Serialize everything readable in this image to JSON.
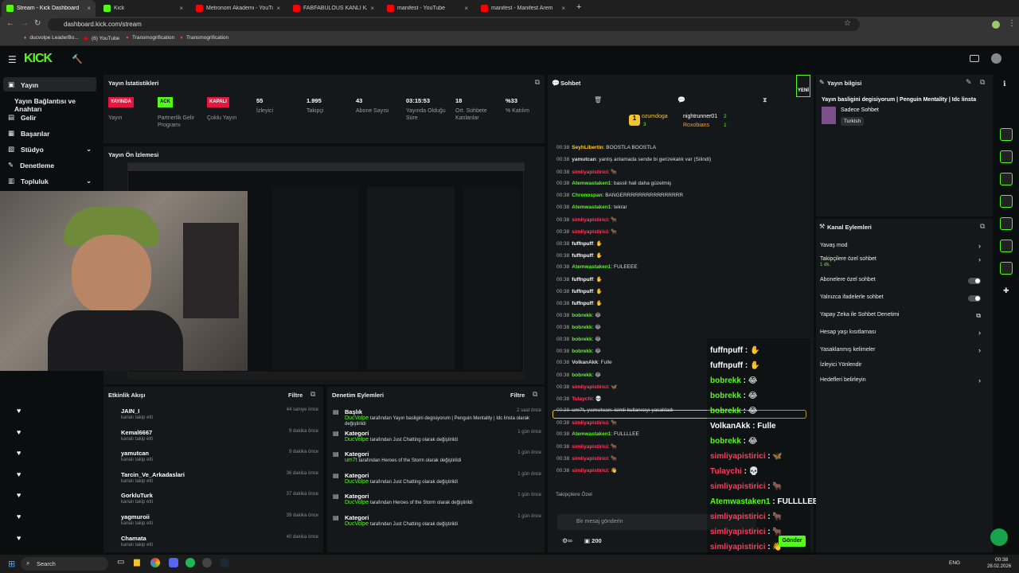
{
  "tabs": [
    {
      "label": "Stream - Kick Dashboard",
      "color": "#53fc18"
    },
    {
      "label": "Kick",
      "color": "#53fc18"
    },
    {
      "label": "Metronom Akademi - YouTube",
      "color": "#ff0000"
    },
    {
      "label": "FABFABULOUS KANLI KATMAN",
      "color": "#ff0000"
    },
    {
      "label": "manifest - YouTube",
      "color": "#ff0000"
    },
    {
      "label": "manifest - Manifest Arem",
      "color": "#ff0000"
    }
  ],
  "address": {
    "url": "dashboard.kick.com/stream"
  },
  "bookmarks": [
    "ducvolpe LeaderBo...",
    "(6) YouTube",
    "Transmogrification",
    "Transmogrification"
  ],
  "sidebar": {
    "items": [
      "Yayın",
      "Yayın Bağlantısı ve Anahtarı",
      "Gelir",
      "Başarılar",
      "Stüdyo",
      "Denetleme",
      "Topluluk"
    ]
  },
  "stats": {
    "title": "Yayın İstatistikleri",
    "status1": "YAYINDA",
    "status1_label": "Yayın",
    "status2": "ACK",
    "status2_label": "Partnerlik Gelir Programı",
    "status3": "KAPALI",
    "status3_label": "Çoklu Yayın",
    "viewers": "55",
    "viewers_label": "İzleyici",
    "followers": "1.995",
    "followers_label": "Takipçi",
    "subs": "43",
    "subs_label": "Abone Sayısı",
    "uptime": "03:15:53",
    "uptime_label": "Yayında Olduğu Süre",
    "chatters": "18",
    "chatters_label": "Ort. Sohbete Katılanlar",
    "part": "%33",
    "part_label": "% Katılım"
  },
  "preview": {
    "title": "Yayın Ön İzlemesi"
  },
  "activity": {
    "title": "Etkinlik Akışı",
    "filter": "Filtre",
    "items": [
      {
        "name": "JAIN_I",
        "desc": "kanalı takip etti",
        "time": "44 saniye önce"
      },
      {
        "name": "Kemal6667",
        "desc": "kanalı takip etti",
        "time": "9 dakika önce"
      },
      {
        "name": "yamutcan",
        "desc": "kanalı takip etti",
        "time": "9 dakika önce"
      },
      {
        "name": "Tarcin_Ve_Arkadaslari",
        "desc": "kanalı takip etti",
        "time": "36 dakika önce"
      },
      {
        "name": "GorkluTurk",
        "desc": "kanalı takip etti",
        "time": "37 dakika önce"
      },
      {
        "name": "yagmuroii",
        "desc": "kanalı takip etti",
        "time": "39 dakika önce"
      },
      {
        "name": "Chamata",
        "desc": "kanalı takip etti",
        "time": "40 dakika önce"
      }
    ]
  },
  "modlog": {
    "title": "Denetim Eylemleri",
    "filter": "Filtre",
    "items": [
      {
        "type": "Başlık",
        "who": "DucVolpe",
        "text": "tarafından Yayın basligini degisiyorum | Penguin Mentality | Idc linsta olarak değiştirildi",
        "time": "2 saat önce"
      },
      {
        "type": "Kategori",
        "who": "DucVolpe",
        "text": "tarafından Just Chatting olarak değiştirildi",
        "time": "1 gün önce"
      },
      {
        "type": "Kategori",
        "who": "um7t",
        "text": "tarafından Heroes of the Storm olarak değiştirildi",
        "time": "1 gün önce"
      },
      {
        "type": "Kategori",
        "who": "DucVolpe",
        "text": "tarafından Just Chatting olarak değiştirildi",
        "time": "1 gün önce"
      },
      {
        "type": "Kategori",
        "who": "DucVolpe",
        "text": "tarafından Heroes of the Storm olarak değiştirildi",
        "time": "1 gün önce"
      },
      {
        "type": "Kategori",
        "who": "DucVolpe",
        "text": "tarafından Just Chatting olarak değiştirildi",
        "time": "1 gün önce"
      }
    ]
  },
  "chat": {
    "title": "Sohbet",
    "new": "YENİ",
    "top1": "ozumdoga",
    "top1_count": "3",
    "top2": "nightrunner01",
    "top2_count": "2",
    "top3": "Roxobians",
    "top3_count": "1",
    "messages": [
      {
        "t": "00:38",
        "u": "SeyhLibertin",
        "c": "#ffcc33",
        "m": "BOOSTLA BOOSTLA"
      },
      {
        "t": "00:38",
        "u": "yamutcan",
        "c": "#ddd",
        "m": "yanlış anlamada sende bi gerizekalık var (Silindi)"
      },
      {
        "t": "00:38",
        "u": "simliyapistirici",
        "c": "#ff3b5c",
        "m": "🐂"
      },
      {
        "t": "00:38",
        "u": "Atemwastaken1",
        "c": "#53fc18",
        "m": "bassli hali daha güzelmiş"
      },
      {
        "t": "00:38",
        "u": "Chronospan",
        "c": "#53fc18",
        "m": "BANGERRRRRRRRRRRRRRRR"
      },
      {
        "t": "00:38",
        "u": "Atemwastaken1",
        "c": "#53fc18",
        "m": "tekrar"
      },
      {
        "t": "00:38",
        "u": "simliyapistirici",
        "c": "#ff3b5c",
        "m": "🐂"
      },
      {
        "t": "00:38",
        "u": "simliyapistirici",
        "c": "#ff3b5c",
        "m": "🐂"
      },
      {
        "t": "00:38",
        "u": "fuffnpuff",
        "c": "#fff",
        "m": "✋"
      },
      {
        "t": "00:38",
        "u": "fuffnpuff",
        "c": "#fff",
        "m": "✋"
      },
      {
        "t": "00:38",
        "u": "Atemwastaken1",
        "c": "#53fc18",
        "m": "FULEEEE"
      },
      {
        "t": "00:38",
        "u": "fuffnpuff",
        "c": "#fff",
        "m": "✋"
      },
      {
        "t": "00:38",
        "u": "fuffnpuff",
        "c": "#fff",
        "m": "✋"
      },
      {
        "t": "00:38",
        "u": "fuffnpuff",
        "c": "#fff",
        "m": "✋"
      },
      {
        "t": "00:38",
        "u": "bobrekk",
        "c": "#53fc18",
        "m": "😂"
      },
      {
        "t": "00:38",
        "u": "bobrekk",
        "c": "#53fc18",
        "m": "😂"
      },
      {
        "t": "00:38",
        "u": "bobrekk",
        "c": "#53fc18",
        "m": "😂"
      },
      {
        "t": "00:38",
        "u": "bobrekk",
        "c": "#53fc18",
        "m": "😂"
      },
      {
        "t": "00:38",
        "u": "VolkanAkk",
        "c": "#ddd",
        "m": "Fulle"
      },
      {
        "t": "00:38",
        "u": "bobrekk",
        "c": "#53fc18",
        "m": "😂"
      },
      {
        "t": "00:38",
        "u": "simliyapistirici",
        "c": "#ff3b5c",
        "m": "🦋"
      },
      {
        "t": "00:38",
        "u": "Tulaychi",
        "c": "#ff3b5c",
        "m": "💀"
      },
      {
        "t": "00:38",
        "u": "um7t, yamutcan",
        "c": "#aaa",
        "m": "isimli kullanıcıyı yasakladı"
      },
      {
        "t": "00:38",
        "u": "simliyapistirici",
        "c": "#ff3b5c",
        "m": "🐂"
      },
      {
        "t": "00:38",
        "u": "Atemwastaken1",
        "c": "#53fc18",
        "m": "FULLLLEE"
      },
      {
        "t": "00:38",
        "u": "simliyapistirici",
        "c": "#ff3b5c",
        "m": "🐂"
      },
      {
        "t": "00:38",
        "u": "simliyapistirici",
        "c": "#ff3b5c",
        "m": "🐂"
      },
      {
        "t": "00:38",
        "u": "simliyapistirici",
        "c": "#ff3b5c",
        "m": "👋"
      }
    ],
    "followers_only": "Takipçilere Özel",
    "placeholder": "Bir mesaj gönderin",
    "points": "200",
    "send": "Gönder"
  },
  "overlay": [
    {
      "u": "fuffnpuff",
      "c": "#fff",
      "m": "✋"
    },
    {
      "u": "fuffnpuff",
      "c": "#fff",
      "m": "✋"
    },
    {
      "u": "bobrekk",
      "c": "#53fc18",
      "m": "😂"
    },
    {
      "u": "bobrekk",
      "c": "#53fc18",
      "m": "😂"
    },
    {
      "u": "bobrekk",
      "c": "#53fc18",
      "m": "😂"
    },
    {
      "u": "VolkanAkk",
      "c": "#fff",
      "m": "Fulle"
    },
    {
      "u": "bobrekk",
      "c": "#53fc18",
      "m": "😂"
    },
    {
      "u": "simliyapistirici",
      "c": "#ff3b5c",
      "m": "🦋"
    },
    {
      "u": "Tulaychi",
      "c": "#ff3b5c",
      "m": "💀"
    },
    {
      "u": "simliyapistirici",
      "c": "#ff3b5c",
      "m": "🐂"
    },
    {
      "u": "Atemwastaken1",
      "c": "#53fc18",
      "m": "FULLLLEE"
    },
    {
      "u": "simliyapistirici",
      "c": "#ff3b5c",
      "m": "🐂"
    },
    {
      "u": "simliyapistirici",
      "c": "#ff3b5c",
      "m": "🐂"
    },
    {
      "u": "simliyapistirici",
      "c": "#ff3b5c",
      "m": "👋"
    }
  ],
  "info": {
    "title": "Yayın bilgisi",
    "stream_title": "Yayın basligini degisiyorum | Penguin Mentality | Idc linsta",
    "category": "Sadece Sohbet",
    "language": "Turkish"
  },
  "channel": {
    "title": "Kanal Eylemleri",
    "items": [
      {
        "label": "Yavaş mod",
        "sub": "",
        "kind": "arrow"
      },
      {
        "label": "Takipçilere özel sohbet",
        "sub": "1 dk.",
        "kind": "arrow"
      },
      {
        "label": "Abonelere özel sohbet",
        "sub": "",
        "kind": "toggle"
      },
      {
        "label": "Yalnızca ifadelerle sohbet",
        "sub": "",
        "kind": "toggle"
      },
      {
        "label": "Yapay Zeka ile Sohbet Denetimi",
        "sub": "",
        "kind": "ext"
      },
      {
        "label": "Hesap yaşı kısıtlaması",
        "sub": "",
        "kind": "arrow"
      },
      {
        "label": "Yasaklanmış kelimeler",
        "sub": "",
        "kind": "arrow"
      },
      {
        "label": "İzleyici Yönlendir",
        "sub": "",
        "kind": "none"
      },
      {
        "label": "Hedefleri belirleyin",
        "sub": "",
        "kind": "arrow"
      }
    ]
  },
  "taskbar": {
    "search": "Search",
    "lang": "ENG",
    "time": "00:38",
    "date": "28.02.2026"
  },
  "colors": {
    "accent": "#53fc18",
    "live": "#e5173f"
  }
}
